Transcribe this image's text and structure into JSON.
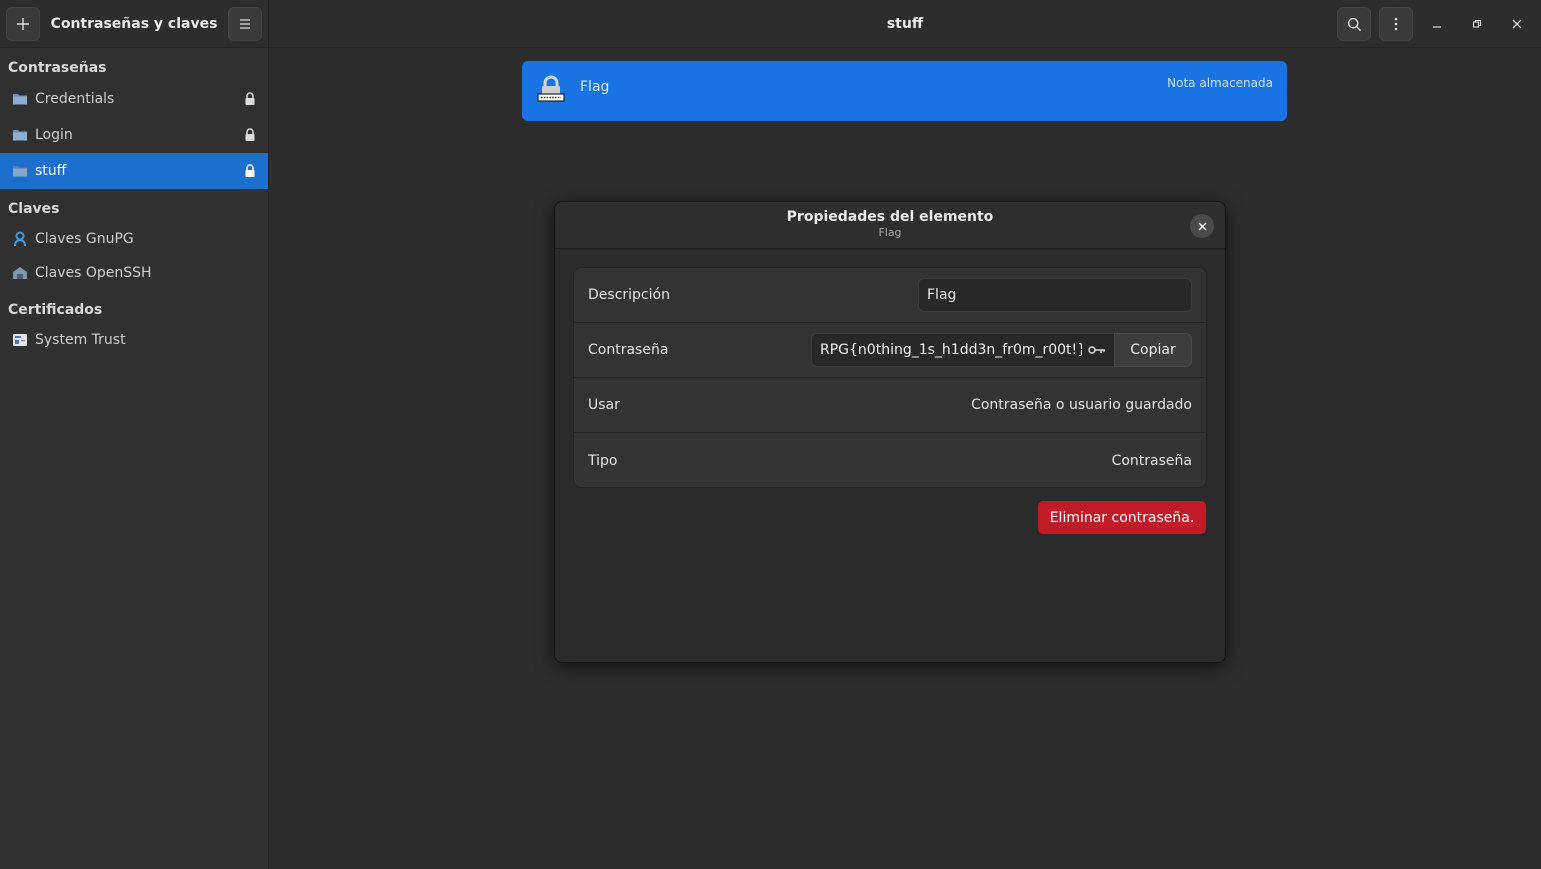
{
  "app": {
    "title": "Contraseñas y claves",
    "window_title": "stuff"
  },
  "sidebar": {
    "sections": [
      {
        "title": "Contraseñas",
        "items": [
          {
            "label": "Credentials",
            "icon": "folder-icon",
            "locked": true
          },
          {
            "label": "Login",
            "icon": "folder-icon",
            "locked": true
          },
          {
            "label": "stuff",
            "icon": "folder-icon",
            "locked": true,
            "selected": true
          }
        ]
      },
      {
        "title": "Claves",
        "items": [
          {
            "label": "Claves GnuPG",
            "icon": "gnupg-key-icon"
          },
          {
            "label": "Claves OpenSSH",
            "icon": "ssh-key-icon"
          }
        ]
      },
      {
        "title": "Certificados",
        "items": [
          {
            "label": "System Trust",
            "icon": "certificate-icon"
          }
        ]
      }
    ]
  },
  "list": {
    "items": [
      {
        "name": "Flag",
        "kind": "Nota almacenada",
        "icon": "stored-note-lock-icon"
      }
    ]
  },
  "dialog": {
    "title": "Propiedades del elemento",
    "subtitle": "Flag",
    "rows": {
      "description": {
        "label": "Descripción",
        "value": "Flag"
      },
      "password": {
        "label": "Contraseña",
        "value": "RPG{n0thing_1s_h1dd3n_fr0m_r00t!}",
        "copy_label": "Copiar"
      },
      "usage": {
        "label": "Usar",
        "value": "Contraseña o usuario guardado"
      },
      "type": {
        "label": "Tipo",
        "value": "Contraseña"
      }
    },
    "delete_label": "Eliminar contraseña."
  },
  "colors": {
    "accent": "#1c6fcd",
    "list_selected": "#1973e2",
    "destructive": "#c01c28"
  }
}
